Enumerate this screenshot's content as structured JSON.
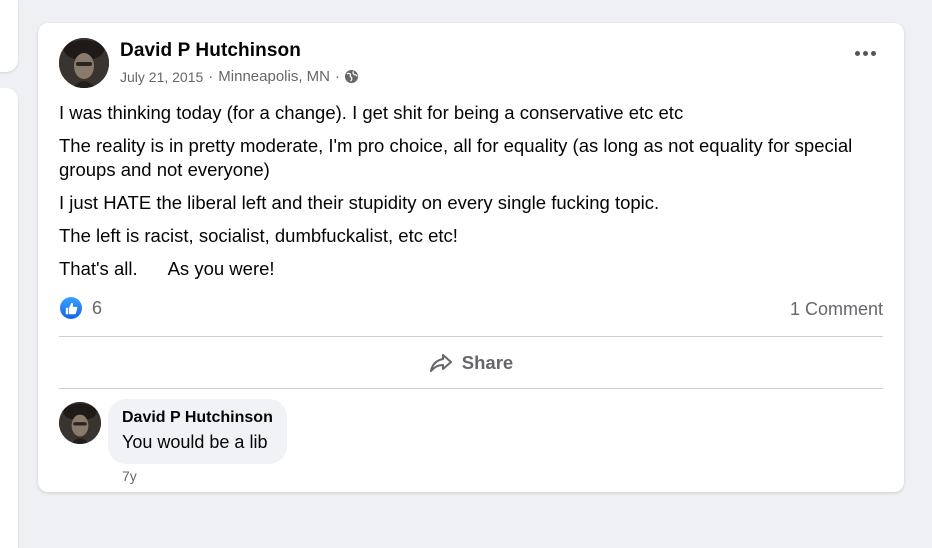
{
  "post": {
    "author": "David P Hutchinson",
    "date": "July 21, 2015",
    "separator": "·",
    "location": "Minneapolis, MN",
    "paragraphs": [
      "I was thinking today (for a change). I get shit for being a conservative etc etc",
      "The reality is in pretty moderate, I'm pro choice, all for equality (as long as not equality for special groups and not everyone)",
      "I just HATE the liberal left and their stupidity on every single fucking topic.",
      "The left is racist, socialist, dumbfuckalist, etc etc!"
    ],
    "last_line_part1": "That's all.",
    "last_line_part2": "As you were!"
  },
  "reactions": {
    "like_count": "6",
    "comment_count": "1 Comment"
  },
  "actions": {
    "share_label": "Share"
  },
  "comment": {
    "author": "David P Hutchinson",
    "text": "You would be a lib",
    "time": "7y"
  },
  "colors": {
    "like_blue": "#1877f2",
    "secondary_text": "#65676b",
    "bubble_bg": "#f0f2f5"
  },
  "icons": [
    "globe-icon",
    "more-options-icon",
    "like-icon",
    "share-icon"
  ]
}
